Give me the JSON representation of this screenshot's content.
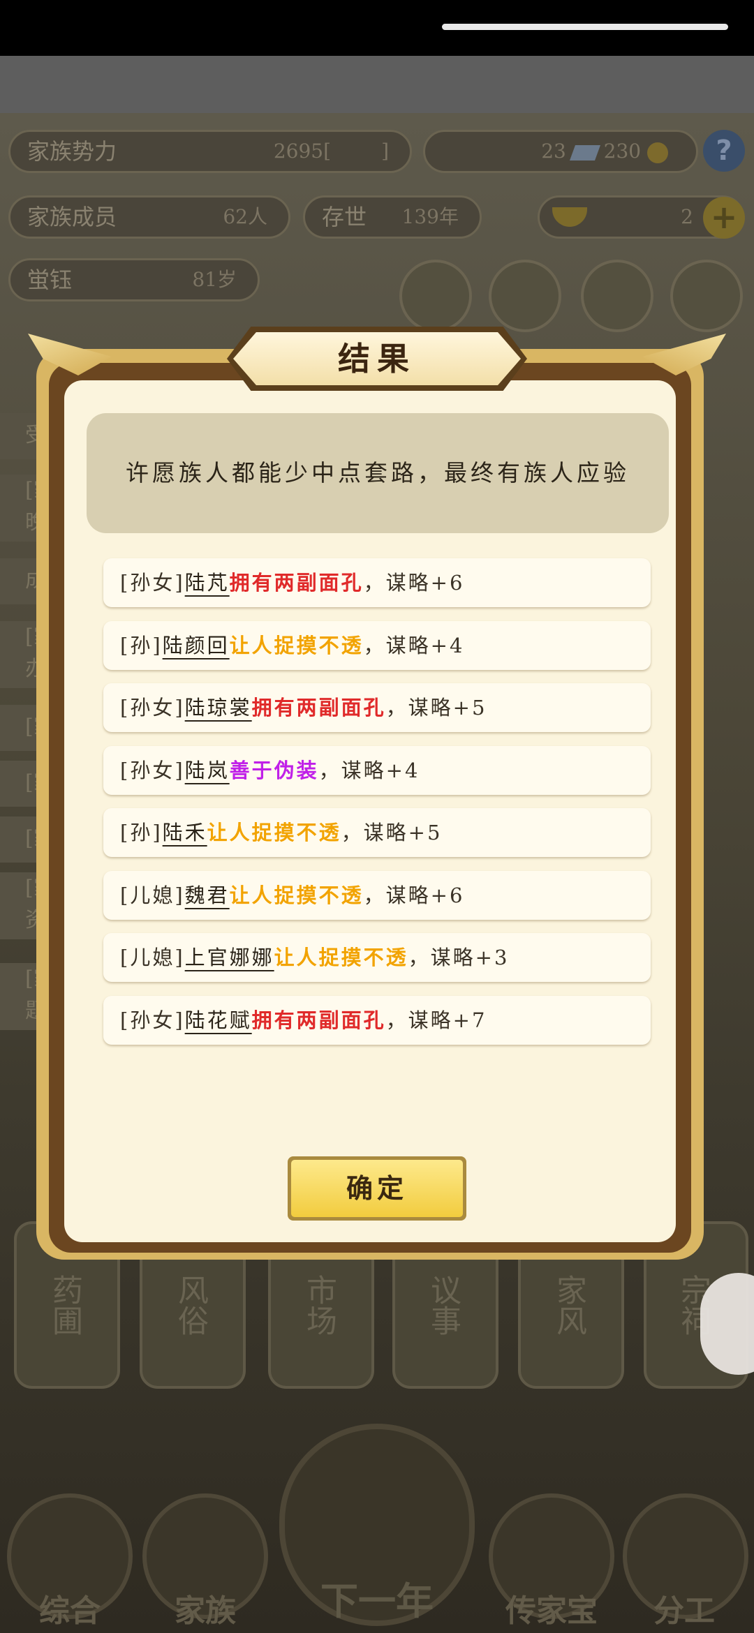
{
  "background": {
    "stats": {
      "power_label": "家族势力",
      "power_value": "2695",
      "power_rank_open": "[",
      "power_rank": "",
      "power_rank_close": "]",
      "currency_a": "23",
      "currency_b": "230",
      "members_label": "家族成员",
      "members_value": "62人",
      "exist_label": "存世",
      "exist_value": "139年",
      "gold_value": "2",
      "elder_label": "蛍钰",
      "elder_value": "81岁"
    },
    "round_buttons": [
      "",
      "",
      "",
      ""
    ],
    "side_rows": [
      "受",
      "[家 晚",
      "成",
      "[家 办",
      "[家",
      "[家",
      "[家",
      "[家 资",
      "[家 题"
    ],
    "bottom_cards": [
      "药圃",
      "风俗",
      "市场",
      "议事",
      "家风",
      "宗祠"
    ],
    "nav": {
      "items": [
        "综合",
        "家族",
        "传家宝",
        "分工"
      ],
      "center": "下一年"
    }
  },
  "dialog": {
    "title": "结果",
    "message": "许愿族人都能少中点套路，最终有族人应验",
    "results": [
      {
        "relation": "[孙女]",
        "name": "陆芃",
        "trait": "拥有两副面孔",
        "trait_color": "#e02a2a",
        "stat": "，谋略+6"
      },
      {
        "relation": "[孙]",
        "name": "陆颜回",
        "trait": "让人捉摸不透",
        "trait_color": "#f2a300",
        "stat": "，谋略+4"
      },
      {
        "relation": "[孙女]",
        "name": "陆琼裳",
        "trait": "拥有两副面孔",
        "trait_color": "#e02a2a",
        "stat": "，谋略+5"
      },
      {
        "relation": "[孙女]",
        "name": "陆岚",
        "trait": "善于伪装",
        "trait_color": "#c020e8",
        "stat": "，谋略+4"
      },
      {
        "relation": "[孙]",
        "name": "陆禾",
        "trait": "让人捉摸不透",
        "trait_color": "#f2a300",
        "stat": "，谋略+5"
      },
      {
        "relation": "[儿媳]",
        "name": "魏君",
        "trait": "让人捉摸不透",
        "trait_color": "#f2a300",
        "stat": "，谋略+6"
      },
      {
        "relation": "[儿媳]",
        "name": "上官娜娜",
        "trait": "让人捉摸不透",
        "trait_color": "#f2a300",
        "stat": "，谋略+3"
      },
      {
        "relation": "[孙女]",
        "name": "陆花赋",
        "trait": "拥有两副面孔",
        "trait_color": "#e02a2a",
        "stat": "，谋略+7"
      }
    ],
    "confirm_label": "确定"
  }
}
